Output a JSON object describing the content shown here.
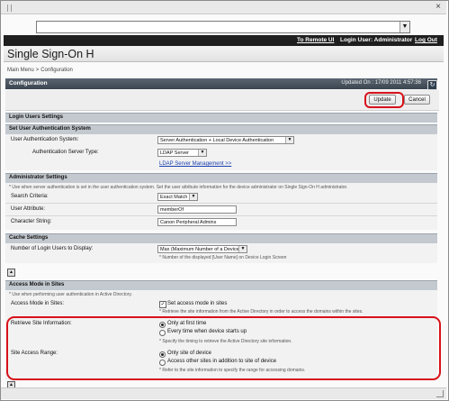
{
  "window": {
    "close_glyph": "×"
  },
  "address_bar": {
    "value": "",
    "dropdown_glyph": "▼"
  },
  "top_stripe": {
    "to_remote_ui": "To Remote UI",
    "login_user": "Login User: Administrator",
    "log_out": "Log Out"
  },
  "brand": {
    "title": "Single Sign-On H"
  },
  "breadcrumb": {
    "main_menu": "Main Menu",
    "sep": ">",
    "current": "Configuration"
  },
  "configuration": {
    "title": "Configuration",
    "updated_on": "Updated On : 17/09 2011 4:57:36",
    "refresh_glyph": "↻",
    "update_button": "Update",
    "cancel_button": "Cancel"
  },
  "login_users_settings": {
    "title": "Login Users Settings"
  },
  "set_user_auth_system": {
    "title": "Set User Authentication System",
    "user_auth_system_label": "User Authentication System:",
    "user_auth_system_value": "Server Authentication + Local Device Authentication",
    "auth_server_type_label": "Authentication Server Type:",
    "auth_server_type_value": "LDAP Server",
    "ldap_link": "LDAP Server Management >>"
  },
  "administrator_settings": {
    "title": "Administrator Settings",
    "note": "* Use when server authentication is set in the user authentication system. Set the user attribute information for the device administrator on Single Sign-On H administrator.",
    "search_criteria_label": "Search Criteria:",
    "search_criteria_value": "Exact Match",
    "user_attribute_label": "User Attribute:",
    "user_attribute_value": "memberOf",
    "character_string_label": "Character String:",
    "character_string_value": "Canon Peripheral Admins"
  },
  "cache_settings": {
    "title": "Cache Settings",
    "num_login_users_label": "Number of Login Users to Display:",
    "num_login_users_value": "Max (Maximum Number of a Device)",
    "num_login_users_note": "* Number of the displayed [User Name] on Device Login Screen"
  },
  "access_mode": {
    "title": "Access Mode in Sites",
    "note": "* Use when performing user authentication in Active Directory.",
    "access_mode_label": "Access Mode in Sites:",
    "access_mode_checkbox": "Set access mode in sites",
    "access_mode_note": "* Retrieve the site information from the Active Directory in order to access the domains within the sites.",
    "retrieve_label": "Retrieve Site Information:",
    "retrieve_opt1": "Only at first time",
    "retrieve_opt2": "Every time when device starts up",
    "retrieve_note": "* Specify the timing to retrieve the Active Directory site information.",
    "range_label": "Site Access Range:",
    "range_opt1": "Only site of device",
    "range_opt2": "Access other sites in addition to site of device",
    "range_note": "* Refer to the site information to specify the range for accessing domains."
  },
  "up_glyph": "▲",
  "check_glyph": "✓",
  "colors": {
    "header_dark": "#1f1f1f",
    "section_bar": "#c3c9cf",
    "highlight": "#d8111a",
    "link": "#1a3fb0"
  }
}
